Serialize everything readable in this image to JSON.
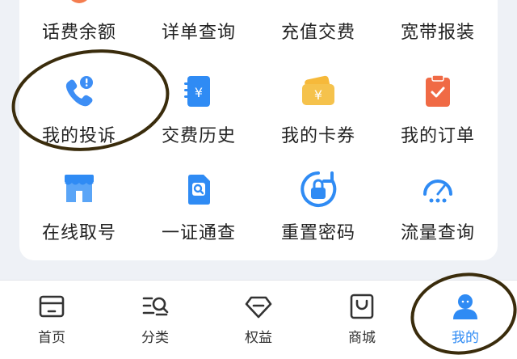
{
  "grid": {
    "row0": [
      "话费余额",
      "详单查询",
      "充值交费",
      "宽带报装"
    ],
    "row1": [
      "我的投诉",
      "交费历史",
      "我的卡券",
      "我的订单"
    ],
    "row2": [
      "在线取号",
      "一证通查",
      "重置密码",
      "流量查询"
    ]
  },
  "tabs": [
    {
      "label": "首页",
      "icon": "home-icon"
    },
    {
      "label": "分类",
      "icon": "category-search-icon"
    },
    {
      "label": "权益",
      "icon": "diamond-icon"
    },
    {
      "label": "商城",
      "icon": "shopping-bag-icon"
    },
    {
      "label": "我的",
      "icon": "user-icon"
    }
  ],
  "active_tab": "我的",
  "colors": {
    "accent": "#2f8bf4",
    "orange": "#f07a4a",
    "annotation": "#3a2c0c"
  }
}
